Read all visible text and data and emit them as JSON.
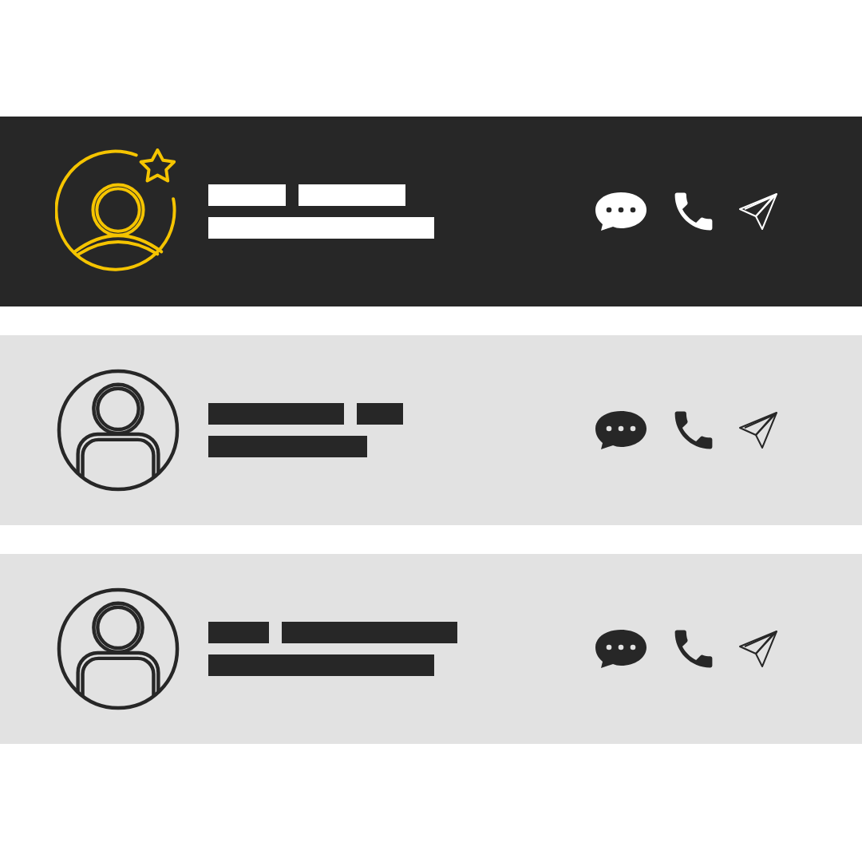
{
  "contacts": [
    {
      "selected": true,
      "favorite": true
    },
    {
      "selected": false,
      "favorite": false
    },
    {
      "selected": false,
      "favorite": false
    }
  ]
}
